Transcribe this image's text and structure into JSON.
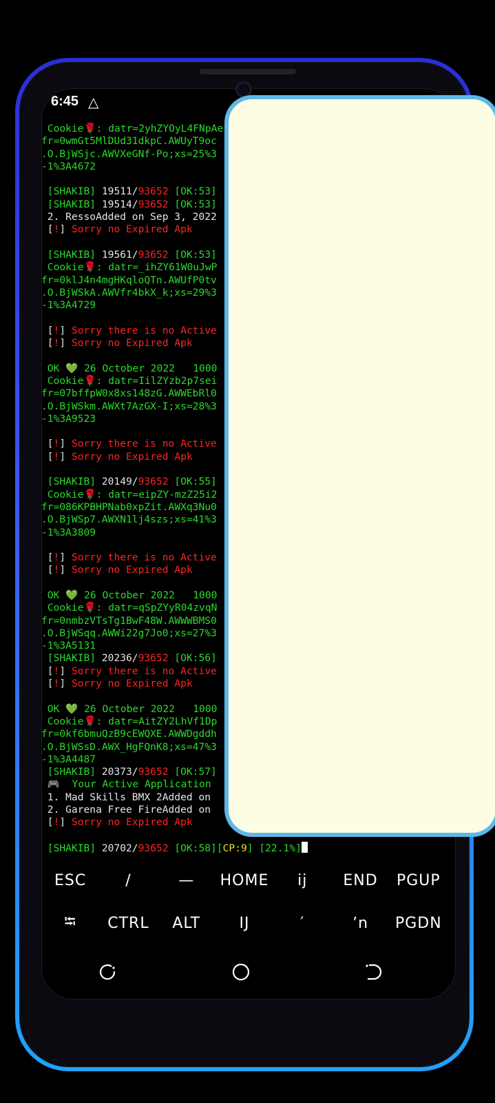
{
  "status_bar": {
    "time": "6:45",
    "icon": "warning-triangle-icon"
  },
  "terminal": {
    "lines": [
      [
        [
          "g",
          " Cookie"
        ],
        [
          "r",
          "🌹"
        ],
        [
          "g",
          ": datr=2yhZYOyL4FNpAe"
        ]
      ],
      [
        [
          "g",
          "fr=0wmGt5MlDUd31dkpC.AWUyT9oc"
        ]
      ],
      [
        [
          "g",
          ".O.BjWSjc.AWVXeGNf-Po;xs=25%3"
        ]
      ],
      [
        [
          "g",
          "-1%3A4672"
        ]
      ],
      [],
      [
        [
          "g",
          " [SHAKIB] "
        ],
        [
          "w",
          "19511/"
        ],
        [
          "r",
          "93652"
        ],
        [
          "w",
          " "
        ],
        [
          "g",
          "[OK:53]"
        ]
      ],
      [
        [
          "g",
          " [SHAKIB] "
        ],
        [
          "w",
          "19514/"
        ],
        [
          "r",
          "93652"
        ],
        [
          "w",
          " "
        ],
        [
          "g",
          "[OK:53]"
        ]
      ],
      [
        [
          "w",
          " 2. RessoAdded on Sep 3, 2022"
        ]
      ],
      [
        [
          "w",
          " ["
        ],
        [
          "r",
          "!"
        ],
        [
          "w",
          "] "
        ],
        [
          "r",
          "Sorry no Expired Apk"
        ]
      ],
      [],
      [
        [
          "g",
          " [SHAKIB] "
        ],
        [
          "w",
          "19561/"
        ],
        [
          "r",
          "93652"
        ],
        [
          "w",
          " "
        ],
        [
          "g",
          "[OK:53]"
        ]
      ],
      [
        [
          "g",
          " Cookie"
        ],
        [
          "r",
          "🌹"
        ],
        [
          "g",
          ": datr=_ihZY61W0uJwP"
        ]
      ],
      [
        [
          "g",
          "fr=0klJ4n4mgHKqloQTn.AWUfP0tv"
        ]
      ],
      [
        [
          "g",
          ".O.BjWSkA.AWVfr4bkX_k;xs=29%3"
        ]
      ],
      [
        [
          "g",
          "-1%3A4729"
        ]
      ],
      [],
      [
        [
          "w",
          " ["
        ],
        [
          "r",
          "!"
        ],
        [
          "w",
          "] "
        ],
        [
          "r",
          "Sorry there is no Active"
        ]
      ],
      [
        [
          "w",
          " ["
        ],
        [
          "r",
          "!"
        ],
        [
          "w",
          "] "
        ],
        [
          "r",
          "Sorry no Expired Apk"
        ]
      ],
      [],
      [
        [
          "g",
          " OK "
        ],
        [
          "g",
          "💚"
        ],
        [
          "g",
          " 26 October 2022   1000"
        ]
      ],
      [
        [
          "g",
          " Cookie"
        ],
        [
          "r",
          "🌹"
        ],
        [
          "g",
          ": datr=IilZYzb2p7sei"
        ]
      ],
      [
        [
          "g",
          "fr=07bffpW0x8xs148zG.AWWEbRl0"
        ]
      ],
      [
        [
          "g",
          ".O.BjWSkm.AWXt7AzGX-I;xs=28%3"
        ]
      ],
      [
        [
          "g",
          "-1%3A9523"
        ]
      ],
      [],
      [
        [
          "w",
          " ["
        ],
        [
          "r",
          "!"
        ],
        [
          "w",
          "] "
        ],
        [
          "r",
          "Sorry there is no Active"
        ]
      ],
      [
        [
          "w",
          " ["
        ],
        [
          "r",
          "!"
        ],
        [
          "w",
          "] "
        ],
        [
          "r",
          "Sorry no Expired Apk"
        ]
      ],
      [],
      [
        [
          "g",
          " [SHAKIB] "
        ],
        [
          "w",
          "20149/"
        ],
        [
          "r",
          "93652"
        ],
        [
          "w",
          " "
        ],
        [
          "g",
          "[OK:55]"
        ]
      ],
      [
        [
          "g",
          " Cookie"
        ],
        [
          "r",
          "🌹"
        ],
        [
          "g",
          ": datr=eipZY-mzZ25i2"
        ]
      ],
      [
        [
          "g",
          "fr=086KPBHPNab0xpZit.AWXq3Nu0"
        ]
      ],
      [
        [
          "g",
          ".O.BjWSp7.AWXN1lj4szs;xs=41%3"
        ]
      ],
      [
        [
          "g",
          "-1%3A3809"
        ]
      ],
      [],
      [
        [
          "w",
          " ["
        ],
        [
          "r",
          "!"
        ],
        [
          "w",
          "] "
        ],
        [
          "r",
          "Sorry there is no Active"
        ]
      ],
      [
        [
          "w",
          " ["
        ],
        [
          "r",
          "!"
        ],
        [
          "w",
          "] "
        ],
        [
          "r",
          "Sorry no Expired Apk"
        ]
      ],
      [],
      [
        [
          "g",
          " OK "
        ],
        [
          "g",
          "💚"
        ],
        [
          "g",
          " 26 October 2022   1000"
        ]
      ],
      [
        [
          "g",
          " Cookie"
        ],
        [
          "r",
          "🌹"
        ],
        [
          "g",
          ": datr=qSpZYyR04zvqN"
        ]
      ],
      [
        [
          "g",
          "fr=0nmbzVTsTg1BwF48W.AWWWBMS0"
        ]
      ],
      [
        [
          "g",
          ".O.BjWSqq.AWWi22g7Jo0;xs=27%3"
        ]
      ],
      [
        [
          "g",
          "-1%3A5131"
        ]
      ],
      [
        [
          "g",
          " [SHAKIB] "
        ],
        [
          "w",
          "20236/"
        ],
        [
          "r",
          "93652"
        ],
        [
          "w",
          " "
        ],
        [
          "g",
          "[OK:56]"
        ]
      ],
      [
        [
          "w",
          " ["
        ],
        [
          "r",
          "!"
        ],
        [
          "w",
          "] "
        ],
        [
          "r",
          "Sorry there is no Active"
        ]
      ],
      [
        [
          "w",
          " ["
        ],
        [
          "r",
          "!"
        ],
        [
          "w",
          "] "
        ],
        [
          "r",
          "Sorry no Expired Apk"
        ]
      ],
      [],
      [
        [
          "g",
          " OK "
        ],
        [
          "g",
          "💚"
        ],
        [
          "g",
          " 26 October 2022   1000"
        ]
      ],
      [
        [
          "g",
          " Cookie"
        ],
        [
          "r",
          "🌹"
        ],
        [
          "g",
          ": datr=AitZY2LhVf1Dp"
        ]
      ],
      [
        [
          "g",
          "fr=0kf6bmuQzB9cEWQXE.AWWDgddh"
        ]
      ],
      [
        [
          "g",
          ".O.BjWSsD.AWX_HgFQnK8;xs=47%3"
        ]
      ],
      [
        [
          "g",
          "-1%3A4487"
        ]
      ],
      [
        [
          "g",
          " [SHAKIB] "
        ],
        [
          "w",
          "20373/"
        ],
        [
          "r",
          "93652"
        ],
        [
          "w",
          " "
        ],
        [
          "g",
          "[OK:57]"
        ]
      ],
      [
        [
          "w",
          " 🎮  "
        ],
        [
          "g",
          "Your Active Application"
        ]
      ],
      [
        [
          "w",
          " 1. Mad Skills BMX 2Added on"
        ]
      ],
      [
        [
          "w",
          " 2. Garena Free FireAdded on"
        ]
      ],
      [
        [
          "w",
          " ["
        ],
        [
          "r",
          "!"
        ],
        [
          "w",
          "] "
        ],
        [
          "r",
          "Sorry no Expired Apk"
        ]
      ],
      [],
      [
        [
          "g",
          " [SHAKIB] "
        ],
        [
          "w",
          "20702/"
        ],
        [
          "r",
          "93652"
        ],
        [
          "w",
          " "
        ],
        [
          "g",
          "[OK:58]["
        ],
        [
          "y",
          "CP:9"
        ],
        [
          "g",
          "] ["
        ],
        [
          "g",
          "22.1%"
        ],
        [
          "g",
          "]"
        ]
      ]
    ]
  },
  "extra_keys": {
    "row1": [
      "ESC",
      "/",
      "—",
      "HOME",
      "ij",
      "END",
      "PGUP"
    ],
    "row2": [
      "⭾",
      "CTRL",
      "ALT",
      "IJ",
      "′",
      "ʼn",
      "PGDN"
    ]
  },
  "navbar": {
    "buttons": [
      "recent-apps-icon",
      "home-circle-icon",
      "back-icon"
    ]
  },
  "colors": {
    "overlay_bg": "#fdfde3",
    "overlay_border": "#5db8e8",
    "green": "#2bd92b",
    "red": "#ff2222"
  }
}
